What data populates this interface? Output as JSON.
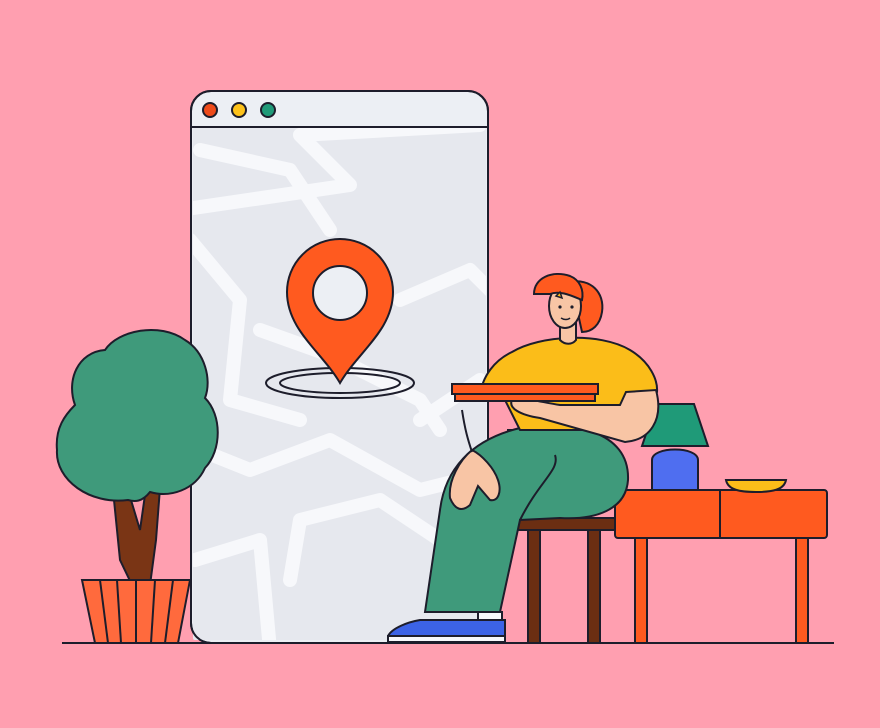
{
  "scene": {
    "kind": "flat illustration",
    "colors": {
      "background": "#ff9fb0",
      "outline": "#1d1d2b",
      "window_frame": "#eceff4",
      "map_surface": "#e6e8ee",
      "map_roads": "#f7f8fb",
      "pin": "#ff5a1f",
      "traffic_red": "#ee4b1a",
      "traffic_yellow": "#fdc21a",
      "traffic_green": "#1f9a78",
      "shirt": "#fbbd19",
      "pants": "#3f9a7b",
      "skin": "#f8c5a5",
      "hair": "#ff5a1f",
      "shoes": "#3c63e6",
      "chair": "#6b2e12",
      "table": "#ff5a1f",
      "lamp_shade": "#1f9a78",
      "lamp_base": "#4f6ef0",
      "bowl": "#fbbd19",
      "tree_foliage": "#3f9a7b",
      "tree_trunk": "#7a3515",
      "pot": "#ff6a3d"
    }
  },
  "icons": {
    "browser_dots": [
      "red-dot-icon",
      "yellow-dot-icon",
      "green-dot-icon"
    ],
    "pin": "map-pin-icon"
  }
}
